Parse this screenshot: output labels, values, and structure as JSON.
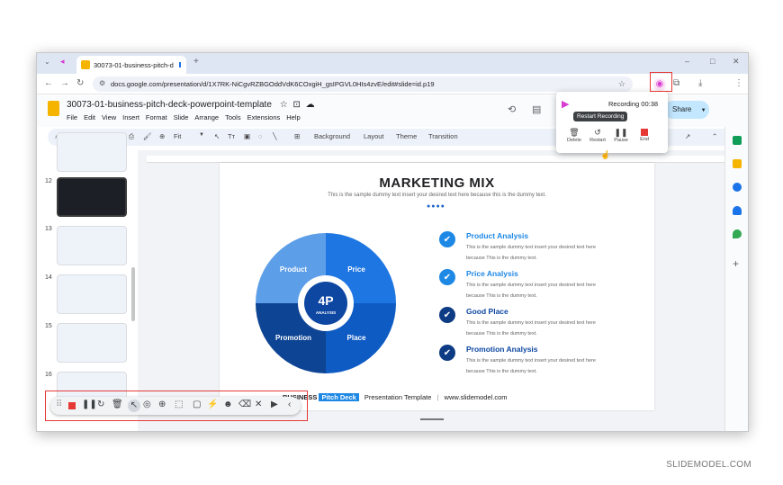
{
  "browser": {
    "tab_title": "30073-01-business-pitch-d",
    "new_tab_symbol": "+",
    "url": "docs.google.com/presentation/d/1X7RK-NiCgvRZBGOddVdK6COxgiH_gsIPGVL0HIs4zvE/edit#slide=id.p19"
  },
  "doc": {
    "title": "30073-01-business-pitch-deck-powerpoint-template",
    "menu": [
      "File",
      "Edit",
      "View",
      "Insert",
      "Format",
      "Slide",
      "Arrange",
      "Tools",
      "Extensions",
      "Help"
    ],
    "share_label": "Share",
    "toolbar": {
      "zoom": "Fit",
      "background": "Background",
      "layout": "Layout",
      "theme": "Theme",
      "transition": "Transition"
    }
  },
  "recording": {
    "status": "Recording 00:38",
    "tooltip": "Restart Recording",
    "controls": [
      "Delete",
      "Restart",
      "Pause",
      "End"
    ]
  },
  "thumbnails": [
    "12",
    "13",
    "14",
    "15",
    "16"
  ],
  "slide": {
    "title": "MARKETING MIX",
    "subtitle": "This is the sample dummy text insert your desired text here because this is the dummy text.",
    "wheel": {
      "center": "4P",
      "center_sub": "ANALYSIS",
      "quadrants": [
        "Product",
        "Price",
        "Promotion",
        "Place"
      ]
    },
    "items": [
      {
        "title": "Product Analysis",
        "line1": "This is the sample dummy text insert your desired text here",
        "line2": "because This is the dummy text."
      },
      {
        "title": "Price Analysis",
        "line1": "This is the sample dummy text insert your desired text here",
        "line2": "because This is the dummy text."
      },
      {
        "title": "Good Place",
        "line1": "This is the sample dummy text insert your desired text here",
        "line2": "because This is the dummy text."
      },
      {
        "title": "Promotion Analysis",
        "line1": "This is the sample dummy text insert your desired text here",
        "line2": "because This is the dummy text."
      }
    ],
    "footer": {
      "brand_a": "BUSINESS",
      "brand_b": "Pitch Deck",
      "template": "Presentation Template",
      "site": "www.slidemodel.com"
    }
  },
  "credit": "SLIDEMODEL.COM",
  "colors": {
    "accent": "#1e88e5",
    "dark_blue": "#0d47a1",
    "red_highlight": "#e53935"
  }
}
